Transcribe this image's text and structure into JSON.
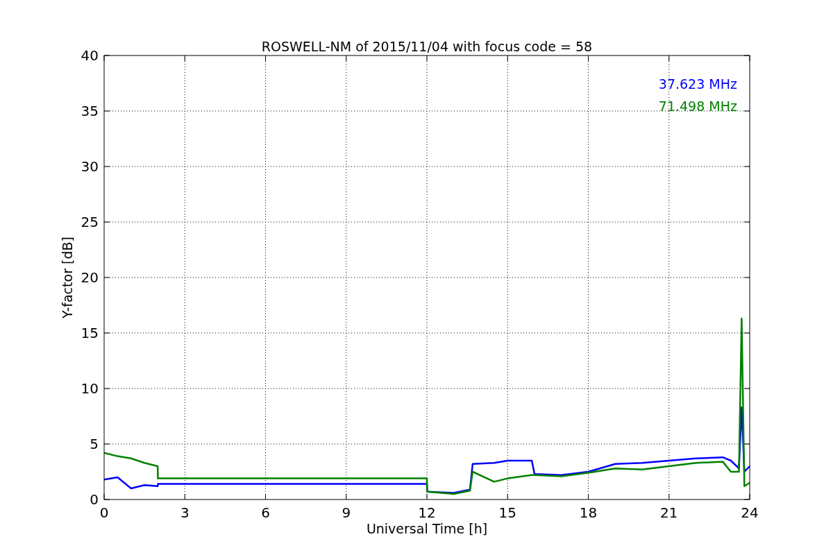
{
  "chart_data": {
    "type": "line",
    "title": "ROSWELL-NM of 2015/11/04 with focus code = 58",
    "xlabel": "Universal Time [h]",
    "ylabel": "Y-factor [dB]",
    "x": [
      0,
      0.5,
      1,
      1.5,
      1.99,
      2,
      12,
      12.01,
      13,
      13.6,
      13.7,
      14.5,
      15,
      15.9,
      16,
      17,
      18,
      19,
      20,
      21,
      22,
      23,
      23.3,
      23.6,
      23.7,
      23.8,
      24
    ],
    "series": [
      {
        "name": "37.623 MHz",
        "color": "#0000ff",
        "values": [
          1.8,
          2.0,
          1.0,
          1.3,
          1.2,
          1.4,
          1.4,
          0.7,
          0.6,
          0.9,
          3.2,
          3.3,
          3.5,
          3.5,
          2.3,
          2.2,
          2.5,
          3.2,
          3.3,
          3.5,
          3.7,
          3.8,
          3.5,
          2.8,
          8.3,
          2.5,
          3.0
        ]
      },
      {
        "name": "71.498 MHz",
        "color": "#008000",
        "values": [
          4.2,
          3.9,
          3.7,
          3.3,
          3.0,
          1.9,
          1.9,
          0.7,
          0.5,
          0.8,
          2.5,
          1.6,
          1.9,
          2.2,
          2.2,
          2.1,
          2.4,
          2.8,
          2.7,
          3.0,
          3.3,
          3.4,
          2.5,
          2.5,
          16.3,
          1.2,
          1.5
        ]
      }
    ],
    "grid": true,
    "xlim": [
      0,
      24
    ],
    "ylim": [
      0,
      40
    ],
    "xticks": [
      0,
      3,
      6,
      9,
      12,
      15,
      18,
      21,
      24
    ],
    "yticks": [
      0,
      5,
      10,
      15,
      20,
      25,
      30,
      35,
      40
    ]
  }
}
